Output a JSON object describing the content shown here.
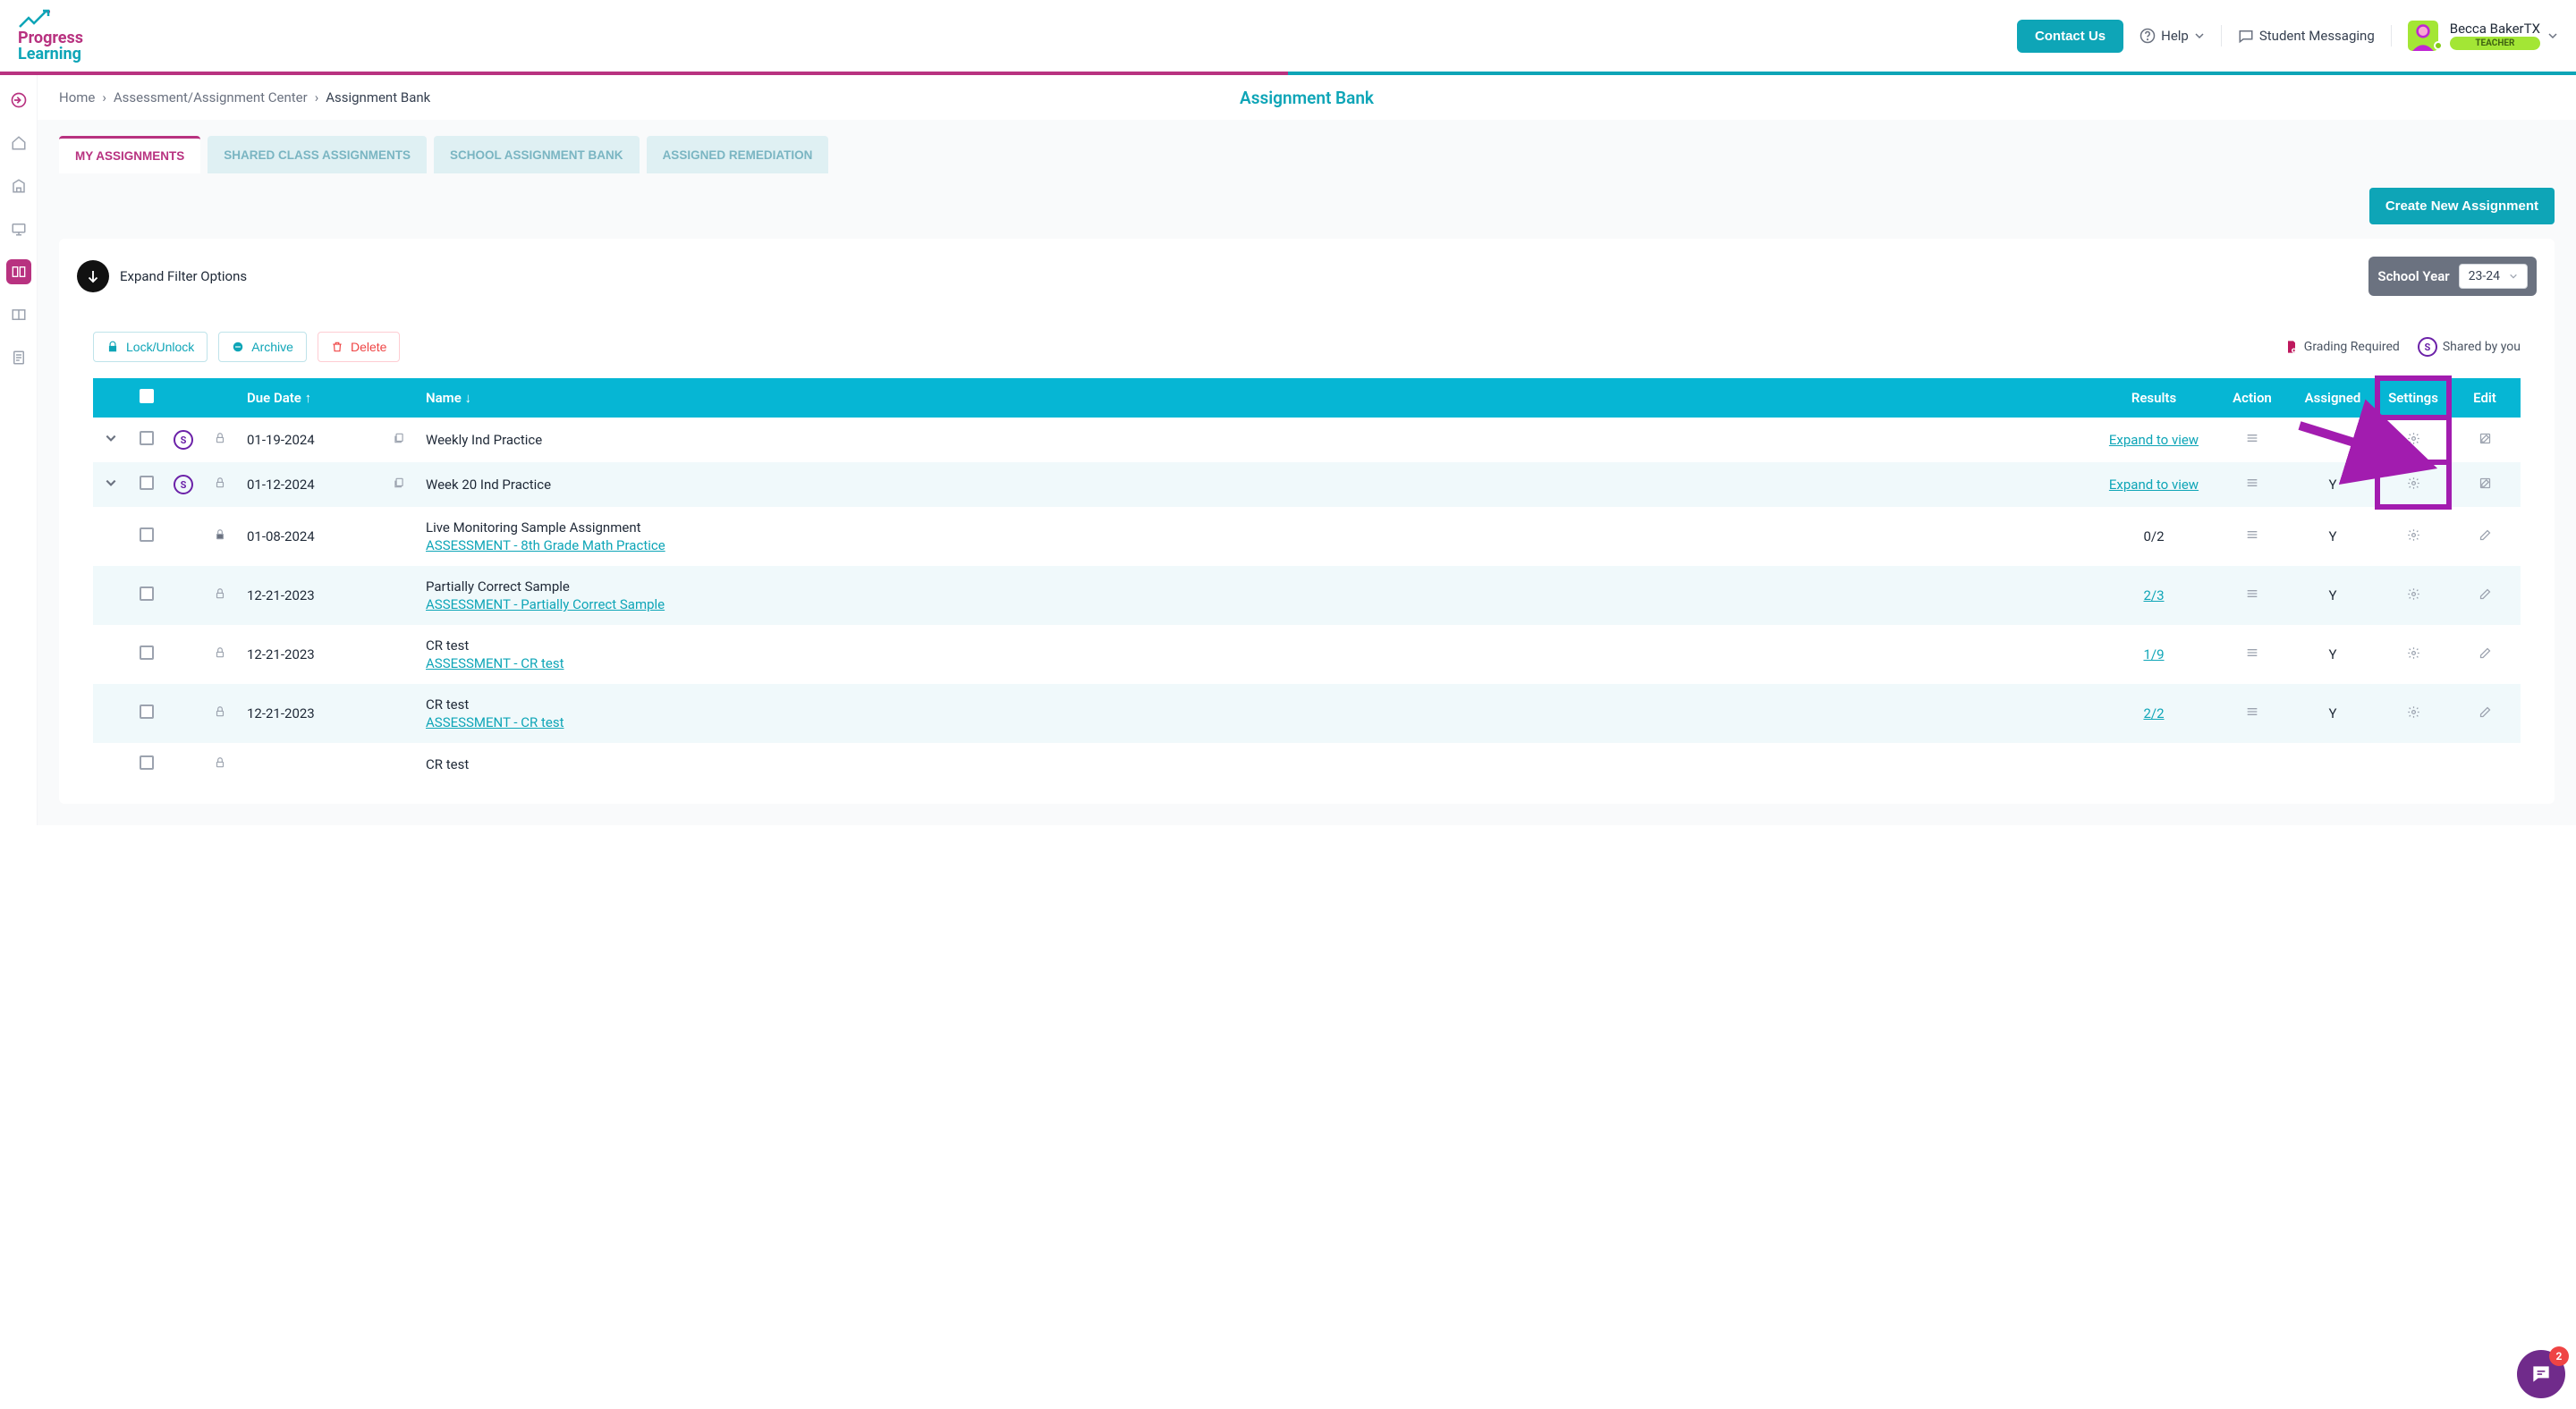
{
  "header": {
    "logo1": "Progress",
    "logo2": "Learning",
    "contact": "Contact Us",
    "help": "Help",
    "messaging": "Student Messaging",
    "user_name": "Becca BakerTX",
    "user_role": "TEACHER"
  },
  "breadcrumb": {
    "home": "Home",
    "center": "Assessment/Assignment Center",
    "current": "Assignment Bank",
    "page_title": "Assignment Bank"
  },
  "tabs": {
    "my": "MY ASSIGNMENTS",
    "shared": "SHARED CLASS ASSIGNMENTS",
    "school": "SCHOOL ASSIGNMENT BANK",
    "remediation": "ASSIGNED REMEDIATION"
  },
  "actions": {
    "create": "Create New Assignment",
    "expand_filter": "Expand Filter Options",
    "school_year_label": "School Year",
    "school_year_value": "23-24"
  },
  "toolbar": {
    "lock": "Lock/Unlock",
    "archive": "Archive",
    "delete": "Delete"
  },
  "legend": {
    "grading": "Grading Required",
    "shared": "Shared by you",
    "s": "S"
  },
  "columns": {
    "due": "Due Date",
    "name": "Name",
    "results": "Results",
    "action": "Action",
    "assigned": "Assigned",
    "settings": "Settings",
    "edit": "Edit"
  },
  "rows": [
    {
      "expandable": true,
      "shared": true,
      "due": "01-19-2024",
      "has_dup": true,
      "name": "Weekly Ind Practice",
      "link": "",
      "results": "Expand to view",
      "results_link": true,
      "assigned": "",
      "edit_type": "box"
    },
    {
      "expandable": true,
      "shared": true,
      "due": "01-12-2024",
      "has_dup": true,
      "name": "Week 20 Ind Practice",
      "link": "",
      "results": "Expand to view",
      "results_link": true,
      "assigned": "Y",
      "edit_type": "box"
    },
    {
      "expandable": false,
      "shared": false,
      "locked": true,
      "due": "01-08-2024",
      "has_dup": false,
      "name": "Live Monitoring Sample Assignment",
      "link": "ASSESSMENT - 8th Grade Math Practice",
      "results": "0/2",
      "results_link": false,
      "assigned": "Y",
      "edit_type": "pencil"
    },
    {
      "expandable": false,
      "shared": false,
      "due": "12-21-2023",
      "has_dup": false,
      "name": "Partially Correct Sample",
      "link": "ASSESSMENT - Partially Correct Sample",
      "results": "2/3",
      "results_link": true,
      "assigned": "Y",
      "edit_type": "pencil"
    },
    {
      "expandable": false,
      "shared": false,
      "due": "12-21-2023",
      "has_dup": false,
      "name": "CR test",
      "link": "ASSESSMENT - CR test",
      "results": "1/9",
      "results_link": true,
      "assigned": "Y",
      "edit_type": "pencil"
    },
    {
      "expandable": false,
      "shared": false,
      "due": "12-21-2023",
      "has_dup": false,
      "name": "CR test",
      "link": "ASSESSMENT - CR test",
      "results": "2/2",
      "results_link": true,
      "assigned": "Y",
      "edit_type": "pencil"
    },
    {
      "expandable": false,
      "shared": false,
      "due": "",
      "has_dup": false,
      "name": "CR test",
      "link": "",
      "results": "",
      "results_link": false,
      "assigned": "",
      "edit_type": ""
    }
  ],
  "chat_count": "2"
}
